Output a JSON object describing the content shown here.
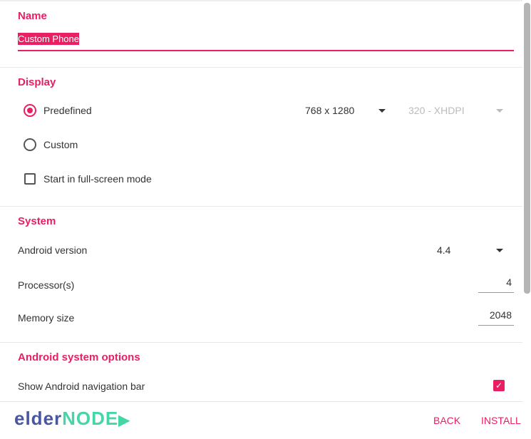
{
  "name": {
    "heading": "Name",
    "value": "Custom Phone"
  },
  "display": {
    "heading": "Display",
    "predefined_label": "Predefined",
    "resolution": "768 x 1280",
    "density": "320 - XHDPI",
    "custom_label": "Custom",
    "fullscreen_label": "Start in full-screen mode"
  },
  "system": {
    "heading": "System",
    "android_version_label": "Android version",
    "android_version": "4.4",
    "processors_label": "Processor(s)",
    "processors": "4",
    "memory_label": "Memory size",
    "memory": "2048"
  },
  "options": {
    "heading": "Android system options",
    "nav_bar_label": "Show Android navigation bar"
  },
  "footer": {
    "logo_part1": "elder",
    "logo_part2": "node",
    "back": "BACK",
    "install": "INSTALL"
  },
  "colors": {
    "accent": "#e91e63"
  }
}
